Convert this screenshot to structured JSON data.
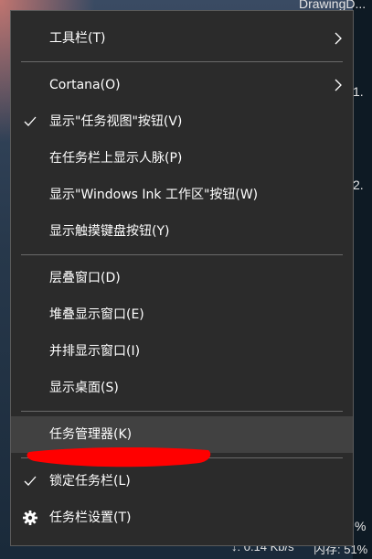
{
  "background": {
    "window_title_snippet": "DrawingD...",
    "right_edge_digit_1": "1.",
    "right_edge_digit_2": "2.",
    "tray_network_speed": "↓: 0.14 Kb/s",
    "tray_memory": "内存: 51%",
    "tray_percent_top": "%"
  },
  "menu": {
    "items": [
      {
        "label": "工具栏(T)",
        "submenu": true,
        "checked": false
      },
      {
        "label": "Cortana(O)",
        "submenu": true,
        "checked": false
      },
      {
        "label": "显示\"任务视图\"按钮(V)",
        "submenu": false,
        "checked": true
      },
      {
        "label": "在任务栏上显示人脉(P)",
        "submenu": false,
        "checked": false
      },
      {
        "label": "显示\"Windows Ink 工作区\"按钮(W)",
        "submenu": false,
        "checked": false
      },
      {
        "label": "显示触摸键盘按钮(Y)",
        "submenu": false,
        "checked": false
      },
      {
        "label": "层叠窗口(D)",
        "submenu": false,
        "checked": false
      },
      {
        "label": "堆叠显示窗口(E)",
        "submenu": false,
        "checked": false
      },
      {
        "label": "并排显示窗口(I)",
        "submenu": false,
        "checked": false
      },
      {
        "label": "显示桌面(S)",
        "submenu": false,
        "checked": false
      },
      {
        "label": "任务管理器(K)",
        "submenu": false,
        "checked": false,
        "highlighted": true
      },
      {
        "label": "锁定任务栏(L)",
        "submenu": false,
        "checked": true
      },
      {
        "label": "任务栏设置(T)",
        "submenu": false,
        "checked": false,
        "icon": "gear-icon"
      }
    ]
  },
  "colors": {
    "menu_bg": "#2b2b2b",
    "hover_bg": "#414141",
    "separator": "#6a6a6a",
    "annotation_red": "#ff0000"
  }
}
